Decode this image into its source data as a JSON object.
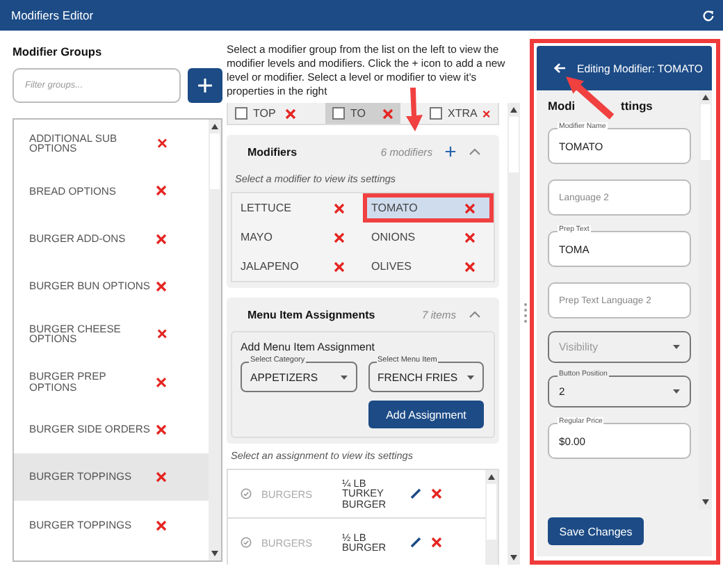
{
  "window": {
    "title": "Modifiers Editor"
  },
  "groups": {
    "heading": "Modifier Groups",
    "filter": {
      "placeholder": "Filter groups..."
    },
    "items": [
      {
        "label": "ADDITIONAL SUB OPTIONS",
        "selected": false
      },
      {
        "label": "BREAD OPTIONS",
        "selected": false
      },
      {
        "label": "BURGER ADD-ONS",
        "selected": false
      },
      {
        "label": "BURGER BUN OPTIONS",
        "selected": false
      },
      {
        "label": "BURGER CHEESE OPTIONS",
        "selected": false
      },
      {
        "label": "BURGER PREP OPTIONS",
        "selected": false
      },
      {
        "label": "BURGER SIDE ORDERS",
        "selected": false
      },
      {
        "label": "BURGER TOPPINGS",
        "selected": true
      },
      {
        "label": "BURGER TOPPINGS",
        "selected": false
      }
    ]
  },
  "instructions": "Select a modifier group from the list on the left to view the modifier levels and modifiers. Click the + icon to add a new level or modifier. Select a level or modifier to view it's properties in the right",
  "levels": [
    {
      "label": "TOP",
      "checked": false,
      "selected": false
    },
    {
      "label": "TO",
      "checked": false,
      "selected": true
    },
    {
      "label": "XTRA",
      "checked": false,
      "selected": false
    }
  ],
  "modifiers": {
    "title": "Modifiers",
    "count": "6 modifiers",
    "expanded": true,
    "hint": "Select a modifier to view its settings",
    "items": [
      {
        "label": "LETTUCE",
        "selected": false
      },
      {
        "label": "TOMATO",
        "selected": true
      },
      {
        "label": "MAYO",
        "selected": false
      },
      {
        "label": "ONIONS",
        "selected": false
      },
      {
        "label": "JALAPENO",
        "selected": false
      },
      {
        "label": "OLIVES",
        "selected": false
      }
    ]
  },
  "assignments": {
    "title": "Menu Item Assignments",
    "count": "7 items",
    "expanded": true,
    "add_heading": "Add Menu Item Assignment",
    "category": {
      "label": "Select Category",
      "value": "APPETIZERS"
    },
    "menu_item": {
      "label": "Select Menu Item",
      "value": "FRENCH FRIES"
    },
    "add_button": "Add Assignment",
    "hint": "Select an assignment to view its settings",
    "rows": [
      {
        "category": "BURGERS",
        "item": "¼ LB TURKEY BURGER"
      },
      {
        "category": "BURGERS",
        "item": "½ LB BURGER"
      }
    ]
  },
  "editor": {
    "title": "Editing Modifier: TOMATO",
    "section_start": "Modi",
    "section_end": "ttings",
    "fields": [
      {
        "kind": "text",
        "label": "Modifier Name",
        "value": "TOMATO"
      },
      {
        "kind": "text",
        "placeholder": "Language 2"
      },
      {
        "kind": "text",
        "label": "Prep Text",
        "value": "TOMA"
      },
      {
        "kind": "text",
        "placeholder": "Prep Text Language 2"
      },
      {
        "kind": "select",
        "placeholder": "Visibility"
      },
      {
        "kind": "select",
        "label": "Button Position",
        "value": "2"
      },
      {
        "kind": "text",
        "label": "Regular Price",
        "value": "$0.00"
      }
    ],
    "save_button": "Save Changes"
  }
}
